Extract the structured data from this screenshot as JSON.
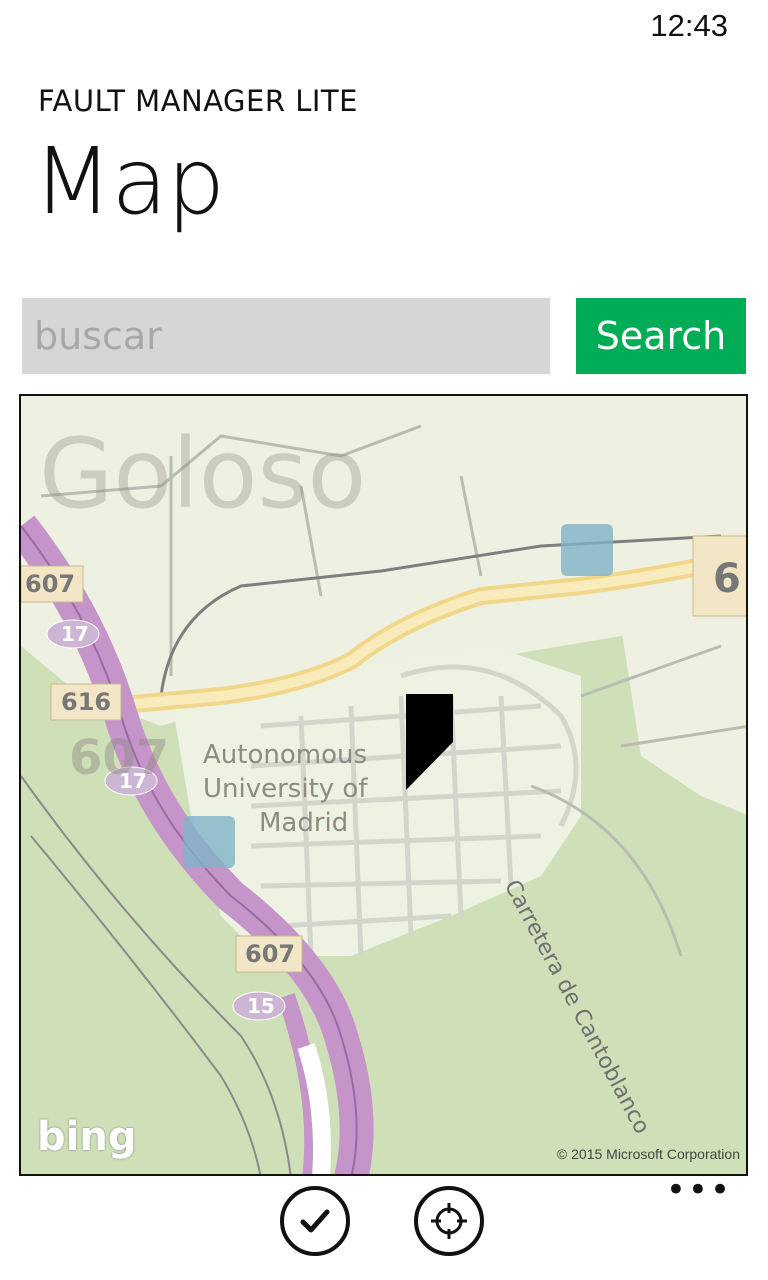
{
  "status_bar": {
    "time": "12:43"
  },
  "header": {
    "app_title": "FAULT MANAGER LITE",
    "page_title": "Map"
  },
  "search": {
    "placeholder": "buscar",
    "value": "",
    "button_label": "Search"
  },
  "map": {
    "labels": {
      "area": "Goloso",
      "university_line1": "Autonomous",
      "university_line2": "University of",
      "university_line3": "Madrid",
      "road_name": "Carretera de Cantoblanco",
      "road_607_a": "607",
      "road_607_b": "607",
      "road_607_c": "607",
      "road_616": "616",
      "road_6": "6",
      "road_17_a": "17",
      "road_17_b": "17",
      "road_15": "15"
    },
    "provider_logo": "bing",
    "copyright": "© 2015 Microsoft Corporation",
    "colors": {
      "land": "#cfe0b8",
      "urban": "#eef2e2",
      "highway": "#c594c8",
      "main_road": "#f7e3a4"
    }
  },
  "app_bar": {
    "buttons": [
      {
        "name": "accept",
        "icon": "check-icon"
      },
      {
        "name": "locate",
        "icon": "locate-icon"
      }
    ],
    "more": "•••"
  }
}
